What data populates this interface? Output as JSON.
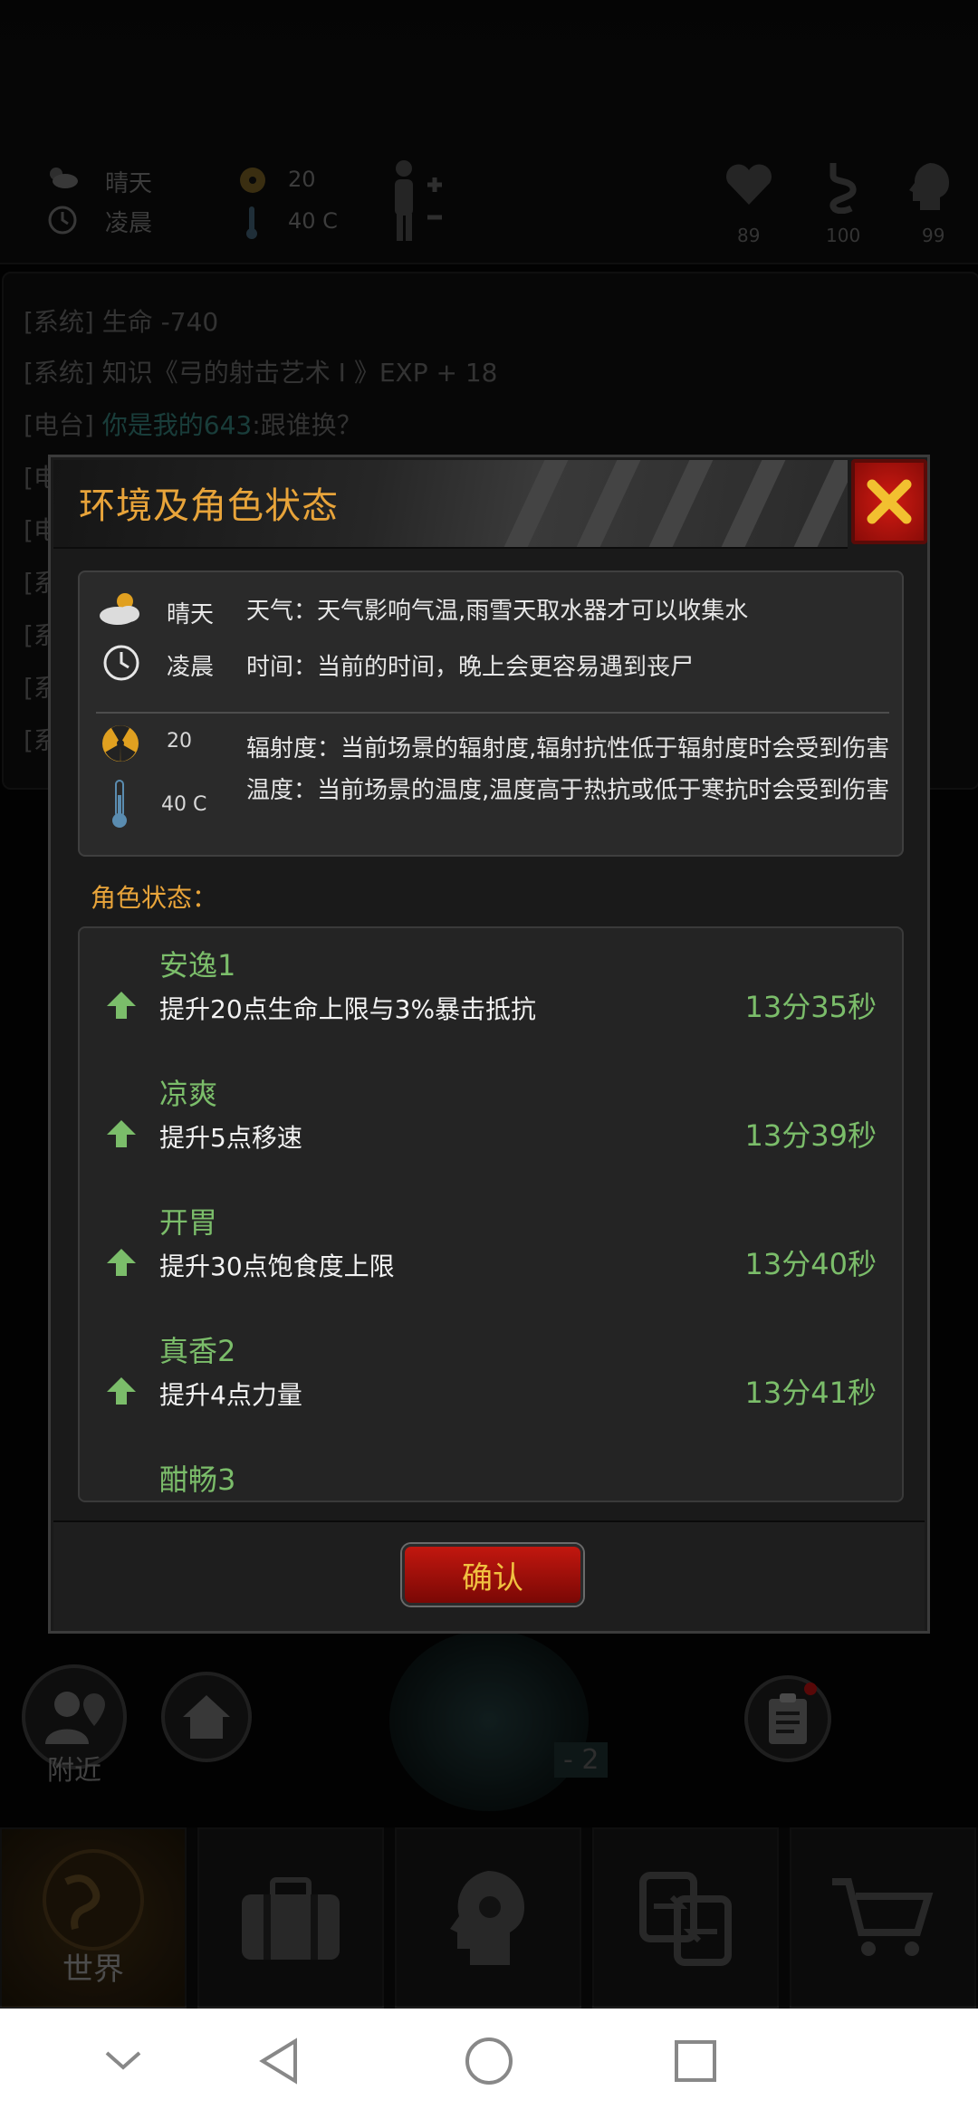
{
  "hud": {
    "weather": "晴天",
    "time": "凌晨",
    "radiation": "20",
    "temperature": "40 C",
    "health": "89",
    "stomach": "100",
    "mind": "99"
  },
  "log": [
    {
      "tag": "[系统]",
      "text": "生命 -740"
    },
    {
      "tag": "[系统]",
      "text": "知识《弓的射击艺术 I 》EXP + 18"
    },
    {
      "tag": "[电台]",
      "highlight": "你是我的643",
      "text": ":跟谁换？"
    },
    {
      "tag": "[电",
      "text": ""
    },
    {
      "tag": "[电",
      "text": ""
    },
    {
      "tag": "[系",
      "text": ""
    },
    {
      "tag": "[系",
      "text": ""
    },
    {
      "tag": "[系",
      "text": ""
    },
    {
      "tag": "[系",
      "text": ""
    }
  ],
  "dialog": {
    "title": "环境及角色状态",
    "environment": {
      "weather_label": "晴天",
      "weather_desc": "天气：天气影响气温,雨雪天取水器才可以收集水",
      "time_label": "凌晨",
      "time_desc": "时间：当前的时间，晚上会更容易遇到丧尸",
      "radiation_value": "20",
      "radiation_desc": "辐射度：当前场景的辐射度,辐射抗性低于辐射度时会受到伤害",
      "temperature_value": "40 C",
      "temperature_desc": "温度：当前场景的温度,温度高于热抗或低于寒抗时会受到伤害"
    },
    "role_status_title": "角色状态：",
    "buffs": [
      {
        "name": "安逸1",
        "desc": "提升20点生命上限与3%暴击抵抗",
        "time": "13分35秒"
      },
      {
        "name": "凉爽",
        "desc": "提升5点移速",
        "time": "13分39秒"
      },
      {
        "name": "开胃",
        "desc": "提升30点饱食度上限",
        "time": "13分40秒"
      },
      {
        "name": "真香2",
        "desc": "提升4点力量",
        "time": "13分41秒"
      },
      {
        "name": "酣畅3",
        "desc": "",
        "time": ""
      }
    ],
    "confirm_label": "确认"
  },
  "bottom": {
    "nearby_label": "附近",
    "radar_value": "- 2",
    "world_label": "世界"
  },
  "colors": {
    "accent_orange": "#e8a43a",
    "buff_green": "#7bbd6a",
    "close_red": "#d01a12"
  }
}
